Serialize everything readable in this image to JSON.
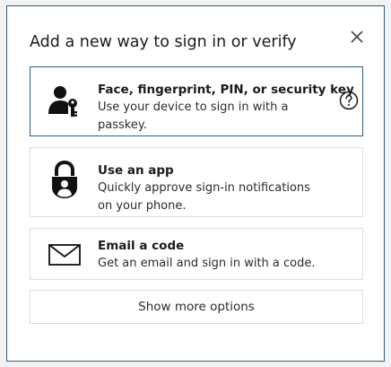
{
  "dialog": {
    "title": "Add a new way to sign in or verify",
    "close_icon": "close-icon"
  },
  "options": [
    {
      "icon": "passkey-user-key-icon",
      "title": "Face, fingerprint, PIN, or security key",
      "desc_line1": "Use your device to sign in with a",
      "desc_line2": "passkey.",
      "help_icon": "help-circle-icon"
    },
    {
      "icon": "authenticator-lock-icon",
      "title": "Use an app",
      "desc_line1": "Quickly approve sign-in notifications",
      "desc_line2": "on your phone."
    },
    {
      "icon": "envelope-icon",
      "title": "Email a code",
      "desc_line1": "Get an email and sign in with a code."
    }
  ],
  "more_options_label": "Show more options",
  "colors": {
    "accent_border": "#2e5e7e",
    "card_border": "#dedede",
    "text": "#1b1b1b"
  }
}
